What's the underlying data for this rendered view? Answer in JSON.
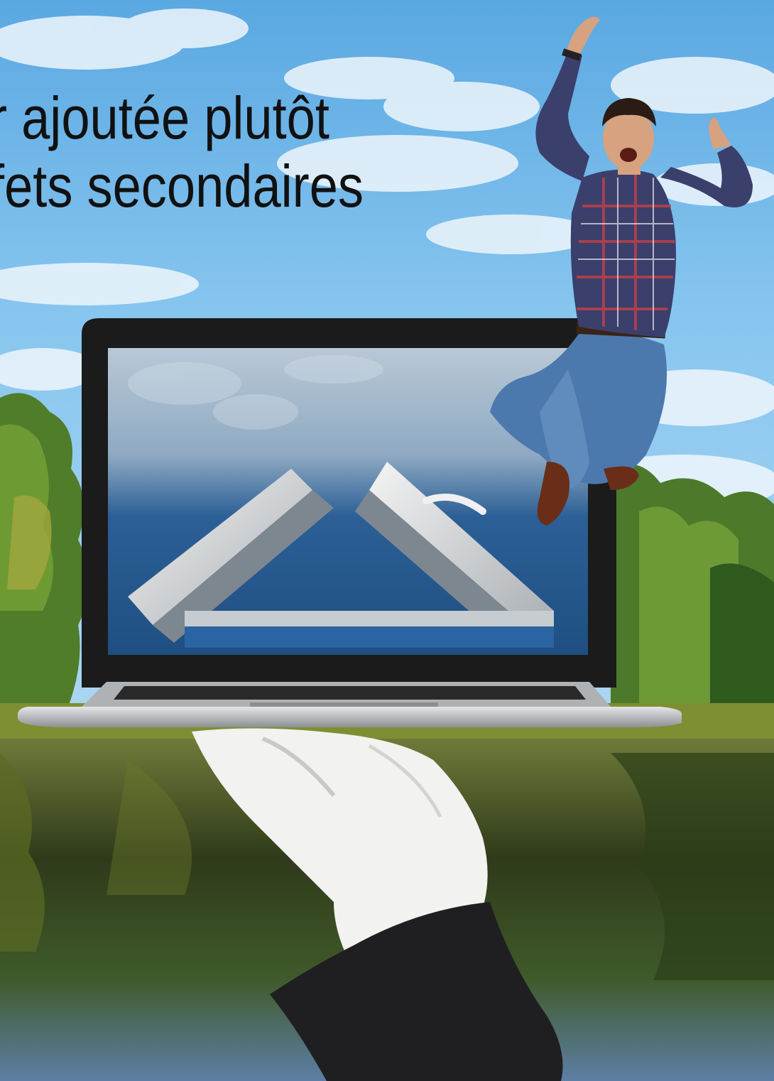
{
  "headline": {
    "line1": "r ajoutée plutôt",
    "line2": "fets secondaires"
  },
  "scene": {
    "sky_color": "#6fb6e6",
    "cloud_color": "#eef6fb",
    "foliage_color": "#4f7d2a",
    "water_color": "#3b3a1e",
    "laptop_frame_color": "#1b1b1b",
    "laptop_body_color": "#c9ccce",
    "screen_sky_color": "#2e6ea6",
    "glove_color": "#f2f2f0",
    "sleeve_color": "#1f1f22",
    "shirt_color": "#3b3f6b",
    "jeans_color": "#4c79ad",
    "skin_color": "#d6a27f",
    "hair_color": "#2a1c14",
    "shoe_color": "#6a2e18"
  },
  "illustration_items": [
    "sky-with-clouds",
    "trees-and-lake",
    "laptop",
    "window-frames-on-screen",
    "white-gloved-hand",
    "jumping-man"
  ]
}
